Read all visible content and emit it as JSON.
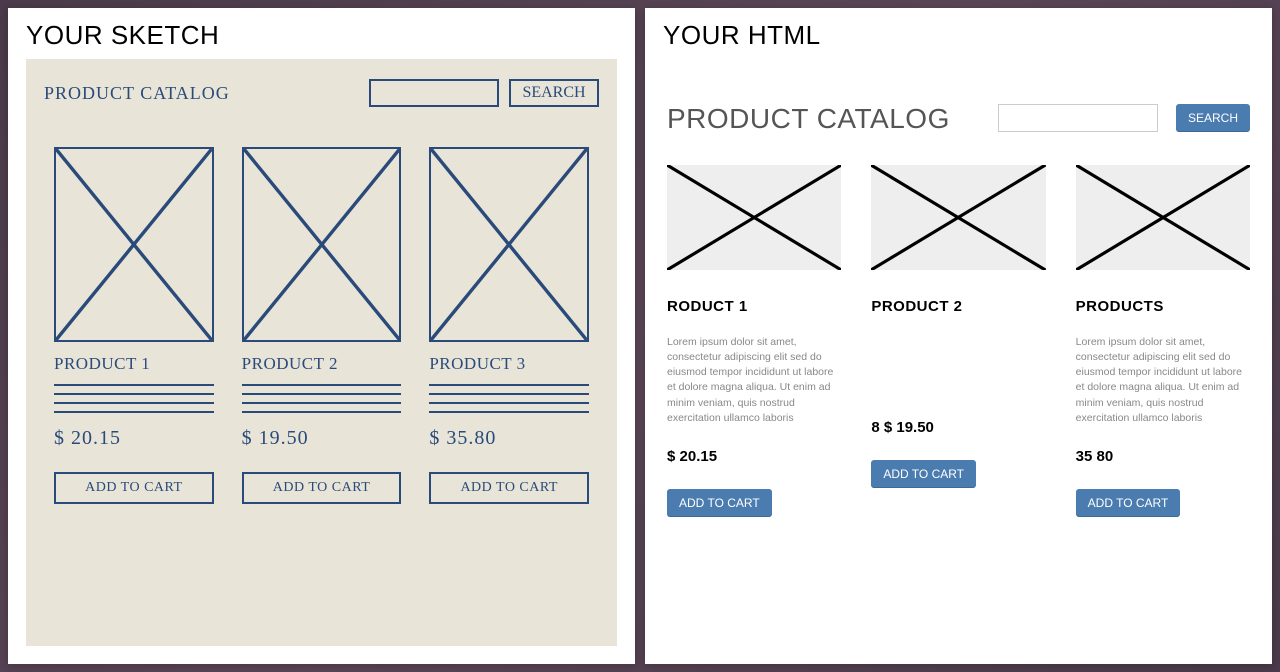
{
  "left": {
    "panel_title": "YOUR SKETCH",
    "catalog_title": "PRODUCT CATALOG",
    "search_btn": "SEARCH",
    "products": [
      {
        "name": "PRODUCT 1",
        "price": "$ 20.15",
        "cart": "ADD TO CART"
      },
      {
        "name": "PRODUCT 2",
        "price": "$ 19.50",
        "cart": "ADD TO CART"
      },
      {
        "name": "PRODUCT 3",
        "price": "$ 35.80",
        "cart": "ADD TO CART"
      }
    ]
  },
  "right": {
    "panel_title": "YOUR HTML",
    "catalog_title": "PRODUCT CATALOG",
    "search_btn": "SEARCH",
    "products": [
      {
        "name": "RODUCT 1",
        "desc": "Lorem ipsum dolor sit amet, consectetur adipiscing elit sed do eiusmod tempor incididunt ut labore et dolore magna aliqua.\nUt enim ad minim veniam, quis nostrud exercitation ullamco laboris",
        "price": "$ 20.15",
        "cart": "ADD TO CART"
      },
      {
        "name": "PRODUCT 2",
        "desc": "",
        "price": "8 $ 19.50",
        "cart": "ADD TO CART"
      },
      {
        "name": "PRODUCTS",
        "desc": "Lorem ipsum dolor sit amet, consectetur adipiscing elit sed do eiusmod tempor incididunt ut labore et dolore magna aliqua.\nUt enim ad minim veniam, quis nostrud exercitation ullamco laboris",
        "price": "35 80",
        "cart": "ADD TO CART"
      }
    ]
  }
}
